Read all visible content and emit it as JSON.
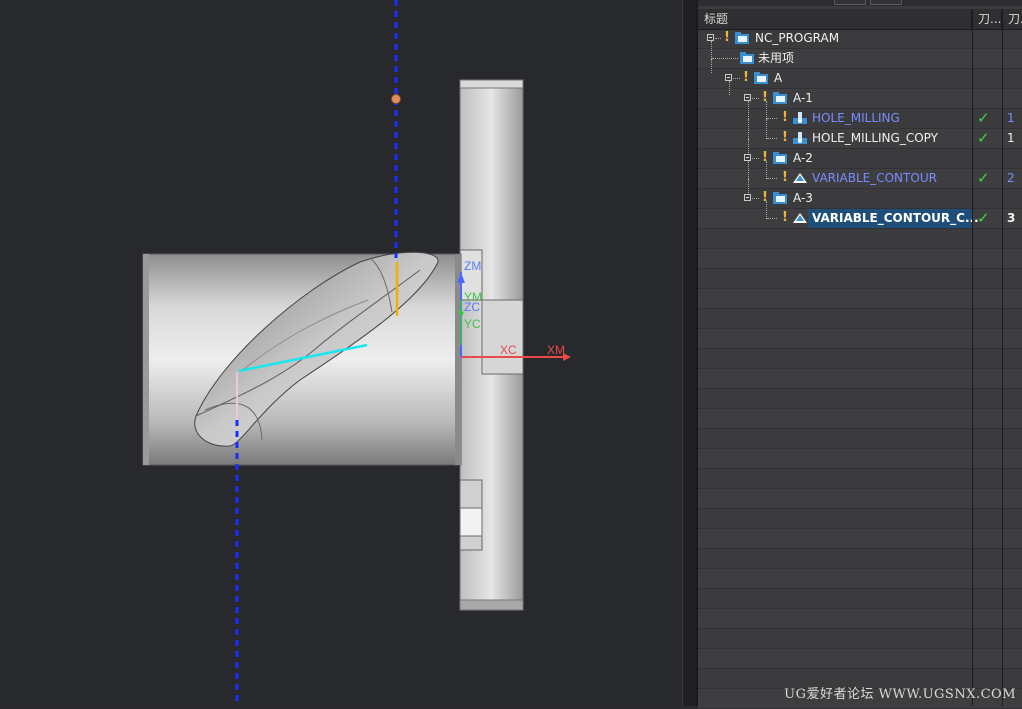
{
  "viewport": {
    "axes": {
      "zm": "ZM",
      "ym": "YM",
      "zc": "ZC",
      "yc": "YC",
      "xc": "XC",
      "xm": "XM"
    },
    "colors": {
      "background": "#28292c",
      "axis_z": "#4a6bff",
      "axis_x": "#e84a4a",
      "axis_y": "#3fc24a",
      "tool_axis": "#1a2eff",
      "toolpath_cyan": "#19e6f0",
      "toolpath_orange": "#f0b400"
    }
  },
  "navigator": {
    "header": {
      "title": "标题",
      "col_tool": "刀...",
      "col_num": "刀..."
    },
    "nodes": [
      {
        "label": "NC_PROGRAM",
        "style": "white",
        "check": "",
        "num": ""
      },
      {
        "label": "未用项",
        "style": "white",
        "check": "",
        "num": ""
      },
      {
        "label": "A",
        "style": "white",
        "check": "",
        "num": ""
      },
      {
        "label": "A-1",
        "style": "white",
        "check": "",
        "num": ""
      },
      {
        "label": "HOLE_MILLING",
        "style": "blue",
        "check": "✓",
        "num": "1"
      },
      {
        "label": "HOLE_MILLING_COPY",
        "style": "white",
        "check": "✓",
        "num": "1"
      },
      {
        "label": "A-2",
        "style": "white",
        "check": "",
        "num": ""
      },
      {
        "label": "VARIABLE_CONTOUR",
        "style": "blue",
        "check": "✓",
        "num": "2"
      },
      {
        "label": "A-3",
        "style": "white",
        "check": "",
        "num": ""
      },
      {
        "label": "VARIABLE_CONTOUR_C...",
        "style": "bold",
        "check": "✓",
        "num": "3"
      }
    ],
    "icons": {
      "program": "program-folder-icon",
      "unused": "unused-folder-icon",
      "group": "group-folder-icon",
      "hole": "hole-milling-icon",
      "contour": "variable-contour-icon",
      "warning": "warning-icon",
      "check": "check-icon"
    },
    "selection_color": "#1f4f78"
  },
  "watermark": "UG爱好者论坛 WWW.UGSNX.COM"
}
